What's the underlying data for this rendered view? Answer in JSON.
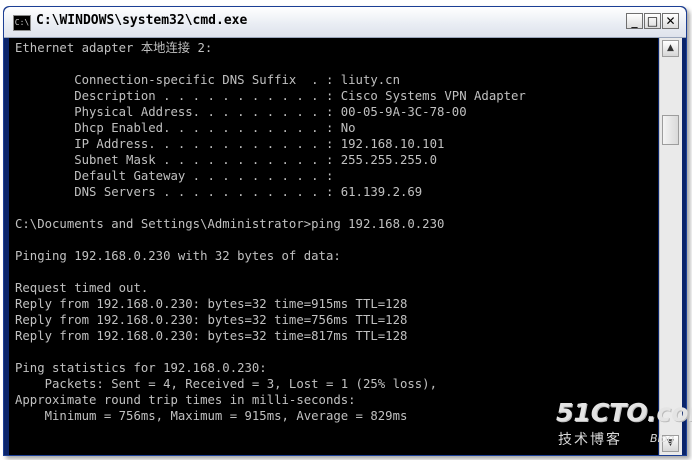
{
  "window": {
    "title": "C:\\WINDOWS\\system32\\cmd.exe",
    "icon_label": "C:\\",
    "buttons": {
      "minimize": "_",
      "maximize": "□",
      "close": "✕"
    }
  },
  "console": {
    "lines": [
      "Ethernet adapter 本地连接 2:",
      "",
      "        Connection-specific DNS Suffix  . : liuty.cn",
      "        Description . . . . . . . . . . . : Cisco Systems VPN Adapter",
      "        Physical Address. . . . . . . . . : 00-05-9A-3C-78-00",
      "        Dhcp Enabled. . . . . . . . . . . : No",
      "        IP Address. . . . . . . . . . . . : 192.168.10.101",
      "        Subnet Mask . . . . . . . . . . . : 255.255.255.0",
      "        Default Gateway . . . . . . . . . :",
      "        DNS Servers . . . . . . . . . . . : 61.139.2.69",
      "",
      "C:\\Documents and Settings\\Administrator>ping 192.168.0.230",
      "",
      "Pinging 192.168.0.230 with 32 bytes of data:",
      "",
      "Request timed out.",
      "Reply from 192.168.0.230: bytes=32 time=915ms TTL=128",
      "Reply from 192.168.0.230: bytes=32 time=756ms TTL=128",
      "Reply from 192.168.0.230: bytes=32 time=817ms TTL=128",
      "",
      "Ping statistics for 192.168.0.230:",
      "    Packets: Sent = 4, Received = 3, Lost = 1 (25% loss),",
      "Approximate round trip times in milli-seconds:",
      "    Minimum = 756ms, Maximum = 915ms, Average = 829ms"
    ]
  },
  "scrollbar": {
    "up_arrow": "▲",
    "down_arrow": "▼"
  },
  "watermark": {
    "main": "51CTO.com",
    "sub": "技术博客",
    "blog": "Blog"
  },
  "colors": {
    "console_bg": "#000000",
    "console_text": "#c0c0c0",
    "titlebar": "#e8ecf3"
  }
}
